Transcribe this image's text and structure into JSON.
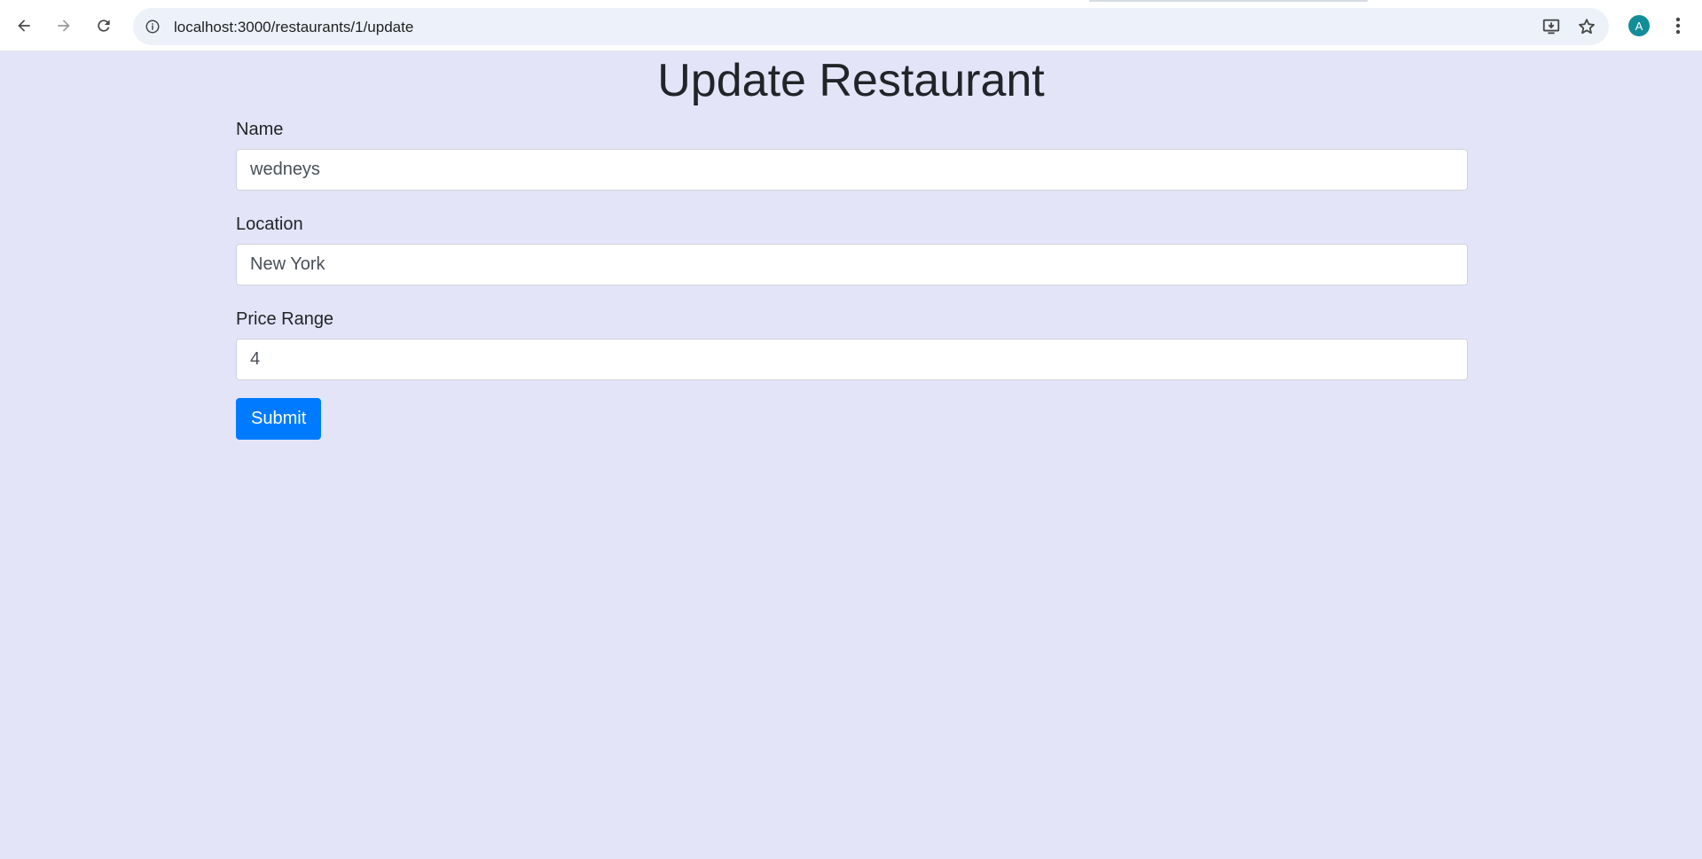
{
  "browser": {
    "url": "localhost:3000/restaurants/1/update",
    "profile_initial": "A",
    "icons": {
      "back": "arrow-left-icon",
      "forward": "arrow-right-icon",
      "reload": "reload-icon",
      "site_info": "info-icon",
      "install": "install-app-icon",
      "bookmark": "star-icon",
      "menu": "kebab-menu-icon"
    }
  },
  "page": {
    "title": "Update Restaurant",
    "background_color": "#e4e4f8"
  },
  "form": {
    "fields": [
      {
        "label": "Name",
        "value": "wedneys"
      },
      {
        "label": "Location",
        "value": "New York"
      },
      {
        "label": "Price Range",
        "value": "4"
      }
    ],
    "submit_label": "Submit",
    "submit_color": "#007bff"
  }
}
